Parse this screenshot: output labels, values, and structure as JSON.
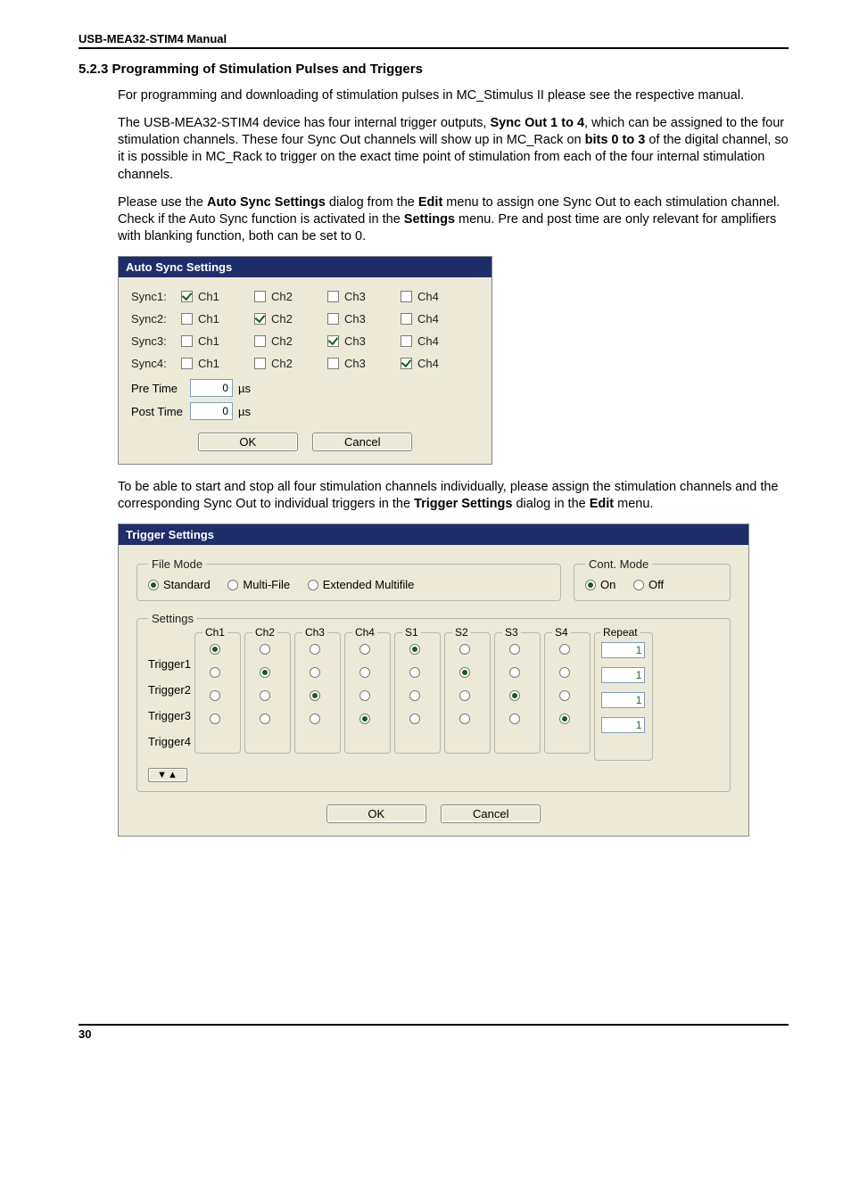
{
  "header": "USB-MEA32-STIM4 Manual",
  "section_number": "5.2.3",
  "section_title": "Programming of Stimulation Pulses and Triggers",
  "paragraphs": {
    "p1": "For programming and downloading of stimulation pulses in MC_Stimulus II please see the respective manual.",
    "p2a": "The USB-MEA32-STIM4 device has four internal trigger outputs, ",
    "p2b_bold": "Sync Out 1 to 4",
    "p2c": ", which can be assigned to the four stimulation channels. These four Sync Out channels will show up in MC_Rack on ",
    "p2d_bold": "bits 0 to 3",
    "p2e": " of the digital channel, so it is possible in MC_Rack to trigger on the exact time point of stimulation from each of the four internal stimulation channels.",
    "p3a": "Please use the ",
    "p3b_bold": "Auto Sync Settings",
    "p3c": " dialog from the ",
    "p3d_bold": "Edit",
    "p3e": " menu to assign one Sync Out to each stimulation channel. Check if the Auto Sync function is activated in the ",
    "p3f_bold": "Settings",
    "p3g": " menu. Pre and post time are only relevant for amplifiers with blanking function, both can be set to 0.",
    "p4a": "To be able to start and stop all four stimulation channels individually, please assign the stimulation channels and the corresponding Sync Out to individual triggers in the ",
    "p4b_bold": "Trigger Settings",
    "p4c": " dialog in the ",
    "p4d_bold": "Edit",
    "p4e": " menu."
  },
  "autosync": {
    "title": "Auto Sync Settings",
    "rows": [
      {
        "label": "Sync1:",
        "ch1": true,
        "ch2": false,
        "ch3": false,
        "ch4": false
      },
      {
        "label": "Sync2:",
        "ch1": false,
        "ch2": true,
        "ch3": false,
        "ch4": false
      },
      {
        "label": "Sync3:",
        "ch1": false,
        "ch2": false,
        "ch3": true,
        "ch4": false
      },
      {
        "label": "Sync4:",
        "ch1": false,
        "ch2": false,
        "ch3": false,
        "ch4": true
      }
    ],
    "cols": {
      "c1": "Ch1",
      "c2": "Ch2",
      "c3": "Ch3",
      "c4": "Ch4"
    },
    "pre_label": "Pre Time",
    "post_label": "Post Time",
    "pre_value": "0",
    "post_value": "0",
    "unit": "µs",
    "ok": "OK",
    "cancel": "Cancel"
  },
  "trigger": {
    "title": "Trigger Settings",
    "filemode_legend": "File Mode",
    "fm_standard": "Standard",
    "fm_multifile": "Multi-File",
    "fm_extmulti": "Extended Multifile",
    "contmode_legend": "Cont. Mode",
    "cm_on": "On",
    "cm_off": "Off",
    "settings_legend": "Settings",
    "col_labels": [
      "Ch1",
      "Ch2",
      "Ch3",
      "Ch4",
      "S1",
      "S2",
      "S3",
      "S4"
    ],
    "repeat_label": "Repeat",
    "row_labels": [
      "Trigger1",
      "Trigger2",
      "Trigger3",
      "Trigger4"
    ],
    "selected_col_for_row": [
      0,
      1,
      2,
      3,
      4,
      5,
      6,
      7
    ],
    "matrix": [
      [
        true,
        false,
        false,
        false,
        true,
        false,
        false,
        false
      ],
      [
        false,
        true,
        false,
        false,
        false,
        true,
        false,
        false
      ],
      [
        false,
        false,
        true,
        false,
        false,
        false,
        true,
        false
      ],
      [
        false,
        false,
        false,
        true,
        false,
        false,
        false,
        true
      ]
    ],
    "repeat_values": [
      "1",
      "1",
      "1",
      "1"
    ],
    "toolbtn": "▼▲",
    "ok": "OK",
    "cancel": "Cancel"
  },
  "pagenum": "30"
}
